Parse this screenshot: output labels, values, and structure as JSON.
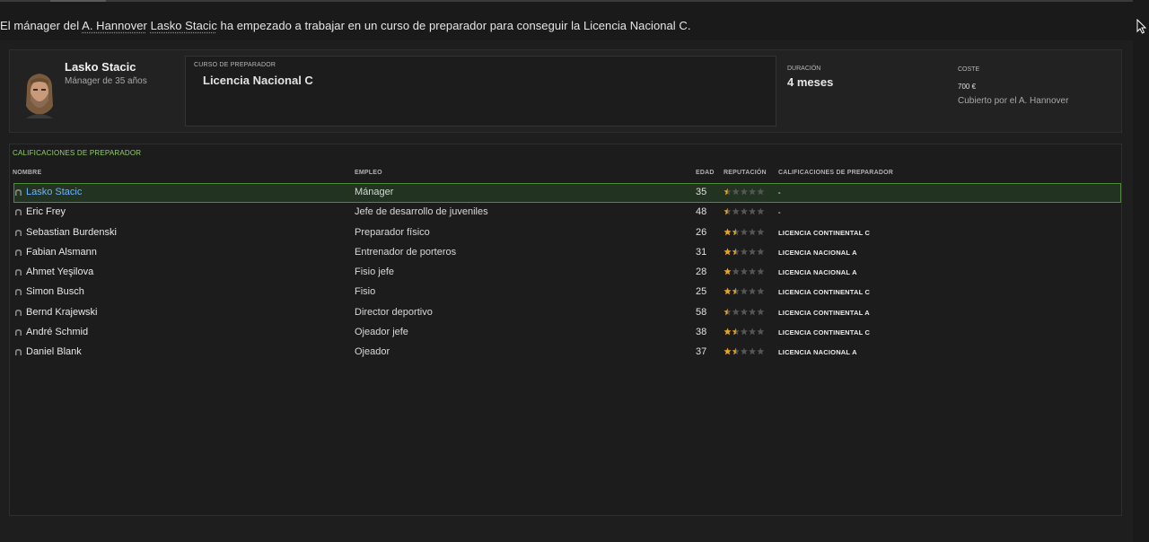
{
  "message": {
    "prefix": "El mánager del ",
    "club_link": "A. Hannover",
    "space": " ",
    "manager_link": "Lasko Stacic",
    "suffix": " ha empezado a trabajar en un curso de preparador para conseguir la Licencia Nacional C."
  },
  "manager": {
    "name": "Lasko Stacic",
    "subtitle": "Mánager de 35 años"
  },
  "course": {
    "label": "CURSO DE PREPARADOR",
    "value": "Licencia Nacional C"
  },
  "duration": {
    "label": "DURACIÓN",
    "value": "4 meses"
  },
  "cost": {
    "label": "COSTE",
    "value": "700 €",
    "note": "Cubierto por el A. Hannover"
  },
  "table": {
    "title": "CALIFICACIONES DE PREPARADOR",
    "headers": {
      "name": "NOMBRE",
      "job": "EMPLEO",
      "age": "EDAD",
      "reputation": "REPUTACIÓN",
      "qualifications": "CALIFICACIONES DE PREPARADOR"
    },
    "rows": [
      {
        "name": "Lasko Stacic",
        "job": "Mánager",
        "age": "35",
        "stars": 0.5,
        "qual": "-",
        "selected": true
      },
      {
        "name": "Eric Frey",
        "job": "Jefe de desarrollo de juveniles",
        "age": "48",
        "stars": 0.5,
        "qual": "-"
      },
      {
        "name": "Sebastian Burdenski",
        "job": "Preparador físico",
        "age": "26",
        "stars": 1.5,
        "qual": "LICENCIA CONTINENTAL C"
      },
      {
        "name": "Fabian Alsmann",
        "job": "Entrenador de porteros",
        "age": "31",
        "stars": 1.5,
        "qual": "LICENCIA NACIONAL A"
      },
      {
        "name": "Ahmet Yeşilova",
        "job": "Fisio jefe",
        "age": "28",
        "stars": 1,
        "qual": "LICENCIA NACIONAL A"
      },
      {
        "name": "Simon Busch",
        "job": "Fisio",
        "age": "25",
        "stars": 1.5,
        "qual": "LICENCIA CONTINENTAL C"
      },
      {
        "name": "Bernd Krajewski",
        "job": "Director deportivo",
        "age": "58",
        "stars": 0.5,
        "qual": "LICENCIA CONTINENTAL A"
      },
      {
        "name": "André Schmid",
        "job": "Ojeador jefe",
        "age": "38",
        "stars": 1.5,
        "qual": "LICENCIA CONTINENTAL C"
      },
      {
        "name": "Daniel Blank",
        "job": "Ojeador",
        "age": "37",
        "stars": 1.5,
        "qual": "LICENCIA NACIONAL A"
      }
    ]
  },
  "colors": {
    "accent_green": "#8fd16a",
    "selected_name": "#6fb2ff",
    "star_gold": "#e7a322",
    "star_empty": "#555555"
  },
  "icons": {
    "person": "person-icon",
    "cursor": "mouse-cursor-icon"
  }
}
